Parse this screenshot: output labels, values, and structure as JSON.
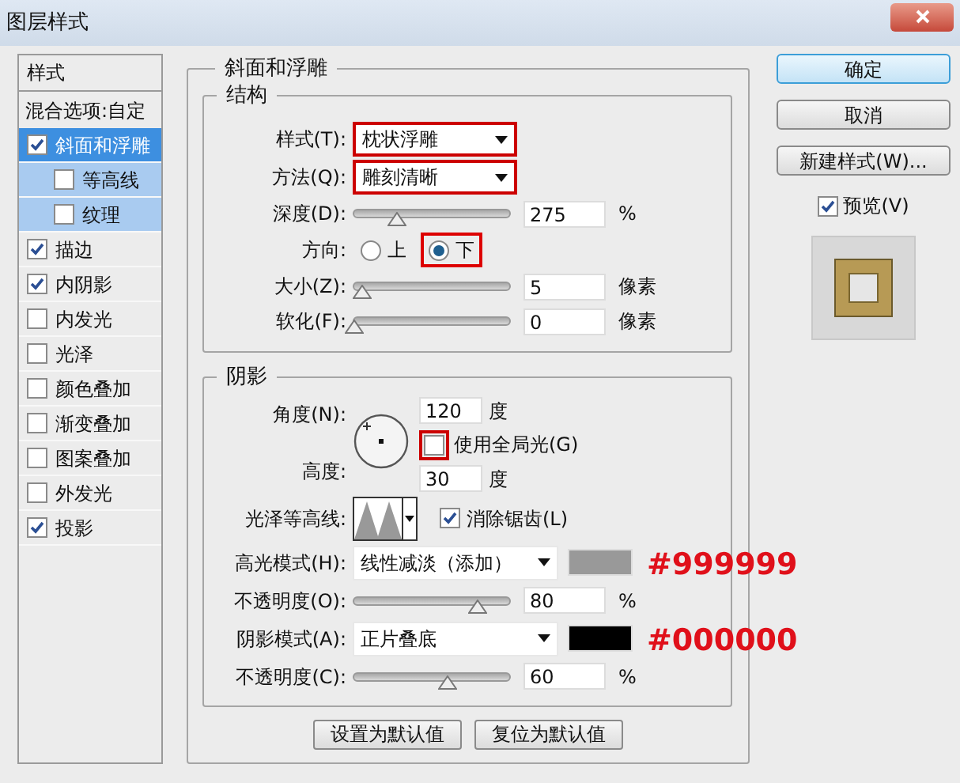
{
  "window": {
    "title": "图层样式"
  },
  "styles_panel": {
    "header": "样式",
    "blending_options": "混合选项:自定",
    "items": [
      {
        "label": "斜面和浮雕",
        "checked": true,
        "selected": true,
        "children": [
          {
            "label": "等高线",
            "checked": false,
            "selected": false
          },
          {
            "label": "纹理",
            "checked": false,
            "selected": false
          }
        ]
      },
      {
        "label": "描边",
        "checked": true,
        "selected": false
      },
      {
        "label": "内阴影",
        "checked": true,
        "selected": false
      },
      {
        "label": "内发光",
        "checked": false,
        "selected": false
      },
      {
        "label": "光泽",
        "checked": false,
        "selected": false
      },
      {
        "label": "颜色叠加",
        "checked": false,
        "selected": false
      },
      {
        "label": "渐变叠加",
        "checked": false,
        "selected": false
      },
      {
        "label": "图案叠加",
        "checked": false,
        "selected": false
      },
      {
        "label": "外发光",
        "checked": false,
        "selected": false
      },
      {
        "label": "投影",
        "checked": true,
        "selected": false
      }
    ]
  },
  "bevel_emboss": {
    "title": "斜面和浮雕",
    "structure": {
      "title": "结构",
      "style": {
        "label": "样式(T):",
        "value": "枕状浮雕",
        "highlighted": true
      },
      "technique": {
        "label": "方法(Q):",
        "value": "雕刻清晰",
        "highlighted": true
      },
      "depth": {
        "label": "深度(D):",
        "level": 0.28,
        "value": "275",
        "unit": "%"
      },
      "direction": {
        "label": "方向:",
        "options": [
          {
            "label": "上",
            "selected": false,
            "highlighted": false
          },
          {
            "label": "下",
            "selected": true,
            "highlighted": true
          }
        ]
      },
      "size": {
        "label": "大小(Z):",
        "level": 0.05,
        "value": "5",
        "unit": "像素"
      },
      "soften": {
        "label": "软化(F):",
        "level": 0,
        "value": "0",
        "unit": "像素"
      }
    },
    "shading": {
      "title": "阴影",
      "angle": {
        "label": "角度(N):",
        "value": "120",
        "unit": "度"
      },
      "global_light": {
        "label": "使用全局光(G)",
        "checked": false,
        "highlighted": true
      },
      "altitude": {
        "label": "高度:",
        "value": "30",
        "unit": "度"
      },
      "gloss_contour": {
        "label": "光泽等高线:"
      },
      "anti_aliased": {
        "label": "消除锯齿(L)",
        "checked": true
      },
      "highlight_mode": {
        "label": "高光模式(H):",
        "value": "线性减淡（添加）",
        "color": "#999999",
        "annotation": "#999999"
      },
      "highlight_opacity": {
        "label": "不透明度(O):",
        "level": 0.8,
        "value": "80",
        "unit": "%"
      },
      "shadow_mode": {
        "label": "阴影模式(A):",
        "value": "正片叠底",
        "color": "#000000",
        "annotation": "#000000"
      },
      "shadow_opacity": {
        "label": "不透明度(C):",
        "level": 0.6,
        "value": "60",
        "unit": "%"
      }
    },
    "buttons": [
      "设置为默认值",
      "复位为默认值"
    ]
  },
  "actions": {
    "buttons": [
      "确定",
      "取消",
      "新建样式(W)..."
    ],
    "preview": {
      "label": "预览(V)",
      "checked": true
    }
  }
}
